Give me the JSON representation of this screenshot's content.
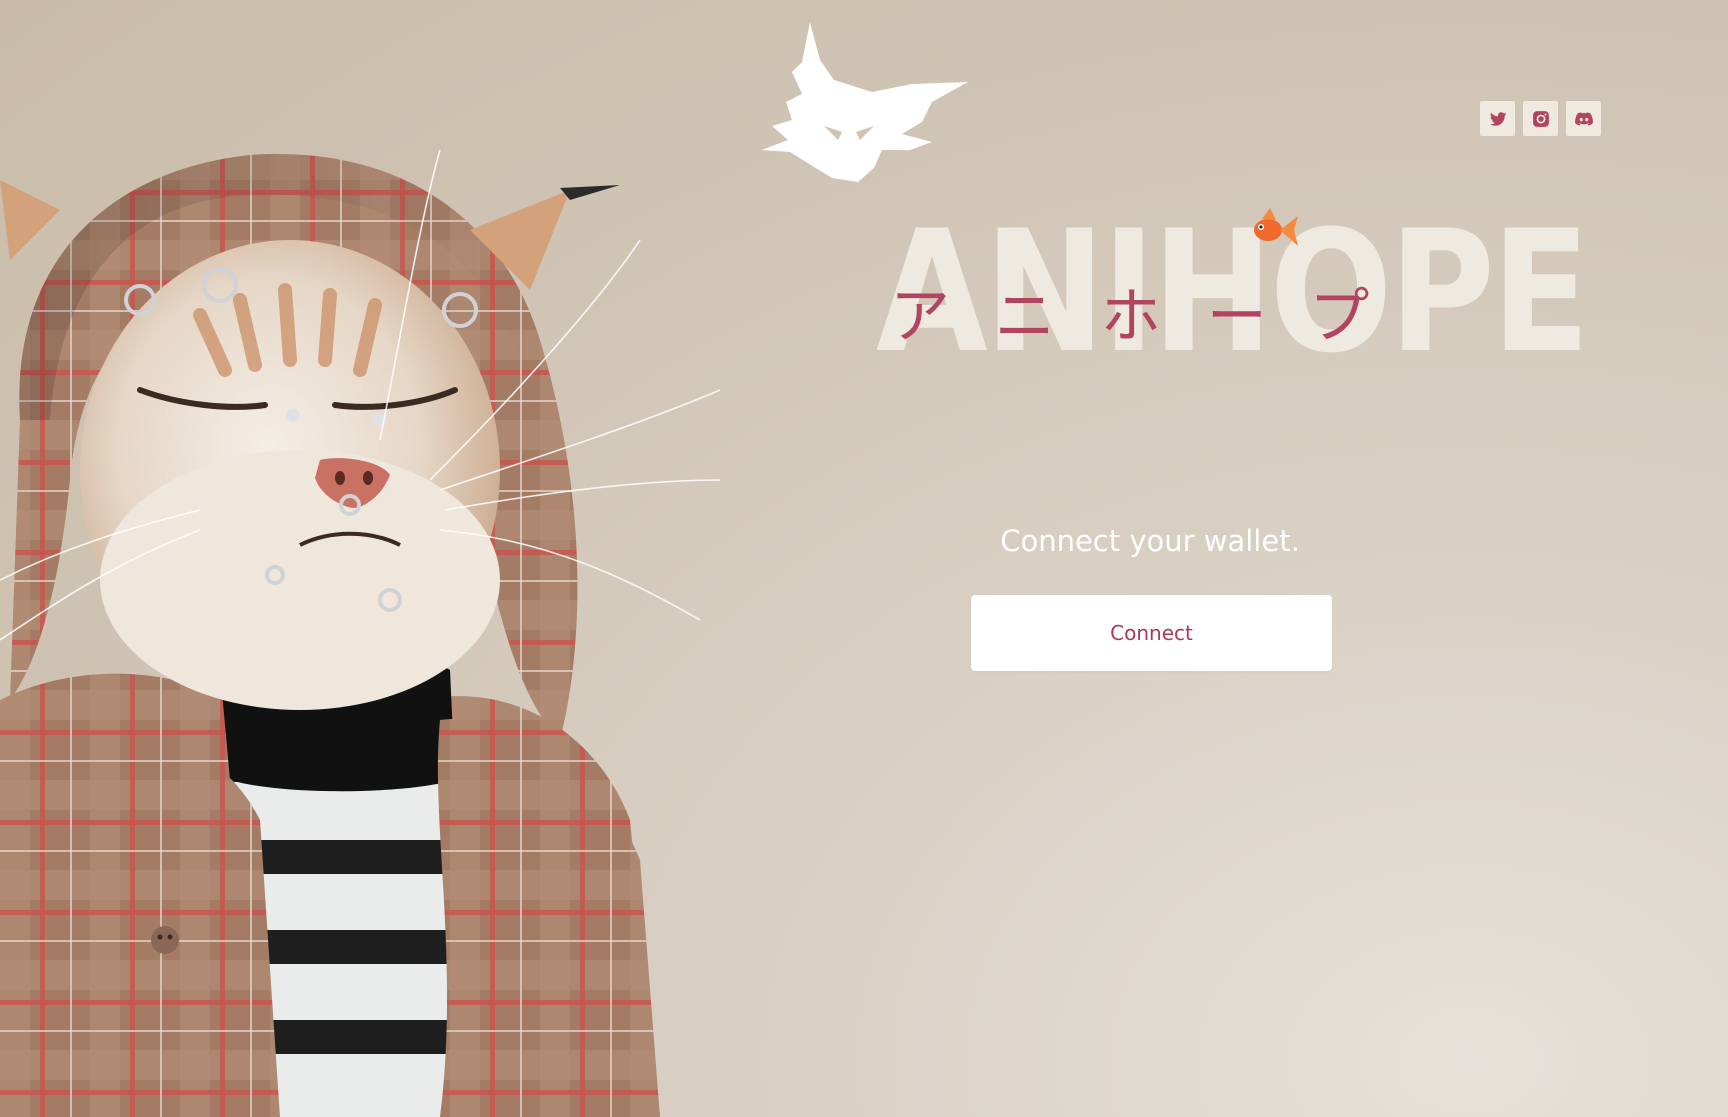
{
  "brand": {
    "wordmark_latin": "ANIHOPE",
    "wordmark_kana": "アニホープ"
  },
  "social": [
    {
      "name": "twitter",
      "icon": "twitter-icon"
    },
    {
      "name": "instagram",
      "icon": "instagram-icon"
    },
    {
      "name": "discord",
      "icon": "discord-icon"
    }
  ],
  "connect": {
    "heading": "Connect your wallet.",
    "button_label": "Connect"
  },
  "colors": {
    "accent": "#b24462",
    "button_text": "#a83a5a",
    "wordmark": "#eeeae2",
    "social_bg": "#efe9df",
    "background": "#d2c6b6"
  }
}
